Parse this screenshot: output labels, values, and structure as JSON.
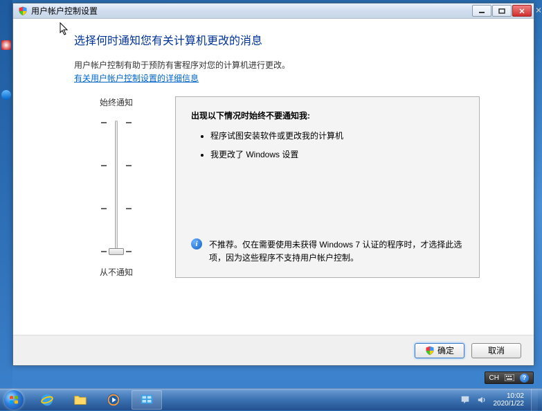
{
  "window": {
    "title": "用户帐户控制设置"
  },
  "page": {
    "heading": "选择何时通知您有关计算机更改的消息",
    "description": "用户帐户控制有助于预防有害程序对您的计算机进行更改。",
    "link": "有关用户帐户控制设置的详细信息"
  },
  "slider": {
    "top_label": "始终通知",
    "bottom_label": "从不通知",
    "position": 3
  },
  "panel": {
    "title": "出现以下情况时始终不要通知我:",
    "bullets": [
      "程序试图安装软件或更改我的计算机",
      "我更改了 Windows 设置"
    ],
    "recommendation": "不推荐。仅在需要使用未获得 Windows 7 认证的程序时，才选择此选项，因为这些程序不支持用户帐户控制。"
  },
  "buttons": {
    "ok": "确定",
    "cancel": "取消"
  },
  "ime": {
    "lang": "CH",
    "kbd": "⌨"
  },
  "tray": {
    "time": "10:02",
    "date": "2020/1/22"
  }
}
